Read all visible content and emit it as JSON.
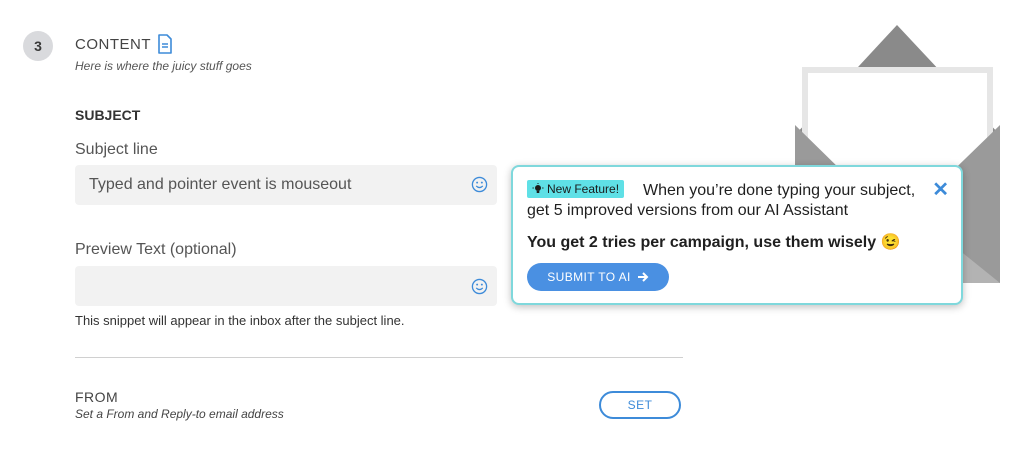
{
  "step": {
    "number": "3",
    "title": "CONTENT",
    "subtitle": "Here is where the juicy stuff goes"
  },
  "subject": {
    "heading": "SUBJECT",
    "subject_label": "Subject line",
    "subject_value": "Typed and pointer event is mouseout",
    "preview_label": "Preview Text (optional)",
    "preview_value": "",
    "preview_hint": "This snippet will appear in the inbox after the subject line."
  },
  "from": {
    "title": "FROM",
    "subtitle": "Set a From and Reply-to email address",
    "set_label": "SET"
  },
  "popover": {
    "tag": "New Feature!",
    "text": "When you’re done typing your subject, get 5 improved versions from our AI Assistant",
    "text_bold": "You get 2 tries per campaign, use them wisely 😉",
    "submit_label": "SUBMIT TO AI",
    "close_label": "✕"
  },
  "colors": {
    "accent": "#3d8bd9",
    "feature_tag": "#5fe0e6",
    "popover_border": "#7fd8dc"
  }
}
